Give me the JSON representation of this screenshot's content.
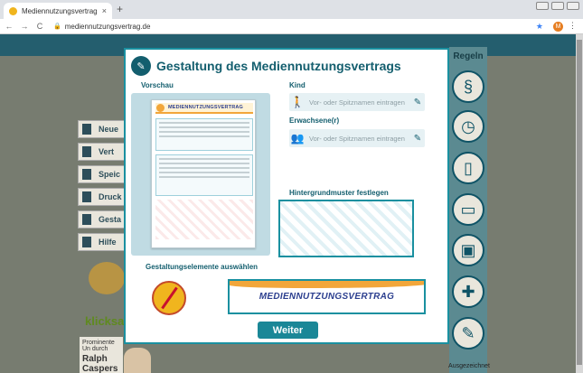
{
  "browser": {
    "tab_title": "Mediennutzungsvertrag",
    "tab_close": "×",
    "new_tab": "+",
    "url": "mediennutzungsvertrag.de",
    "nav_back": "←",
    "nav_forward": "→",
    "nav_reload": "C",
    "profile_initial": "M"
  },
  "background": {
    "menu": [
      "Neue",
      "Vert",
      "Speic",
      "Druck",
      "Gesta",
      "Hilfe"
    ],
    "klick": "klicksa",
    "promi_heading": "Prominente Un durch",
    "promi_name": "Ralph Caspers",
    "right_title": "Regeln",
    "right_footer": "Ausgezeichnet"
  },
  "modal": {
    "title": "Gestaltung des Mediennutzungsvertrags",
    "preview_label": "Vorschau",
    "preview_doc_title": "MEDIENNUTZUNGSVERTRAG",
    "child_label": "Kind",
    "child_placeholder": "Vor- oder Spitznamen eintragen",
    "adult_label": "Erwachsene(r)",
    "adult_placeholder": "Vor- oder Spitznamen eintragen",
    "pattern_label": "Hintergrundmuster festlegen",
    "elements_label": "Gestaltungselemente auswählen",
    "banner_title": "MEDIENNUTZUNGSVERTRAG",
    "next_button": "Weiter"
  }
}
